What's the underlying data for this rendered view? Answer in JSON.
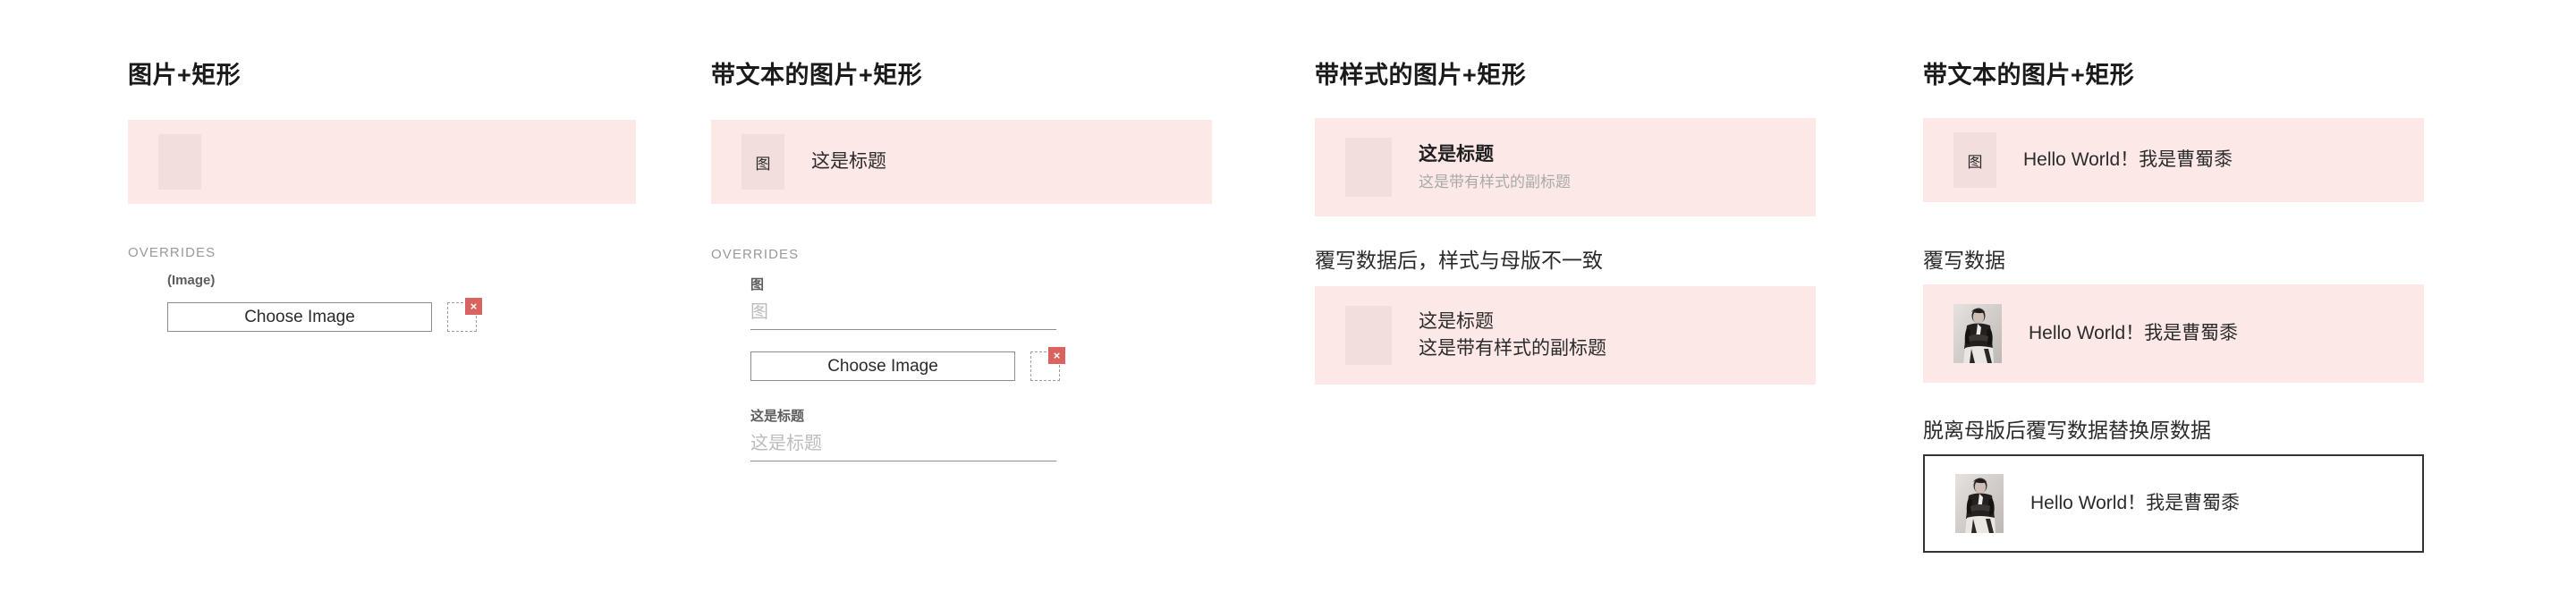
{
  "columns": [
    {
      "heading": "图片+矩形",
      "card": {
        "placeholder_label": ""
      },
      "overrides": {
        "title": "OVERRIDES",
        "image_field_label": "(Image)",
        "choose_image_label": "Choose Image",
        "delete_badge_label": "×"
      }
    },
    {
      "heading": "带文本的图片+矩形",
      "card": {
        "placeholder_label": "图",
        "title": "这是标题"
      },
      "overrides": {
        "title": "OVERRIDES",
        "image_field_label": "图",
        "image_field_placeholder": "图",
        "image_field_value": "",
        "choose_image_label": "Choose Image",
        "delete_badge_label": "×",
        "title_field_label": "这是标题",
        "title_field_placeholder": "这是标题",
        "title_field_value": ""
      }
    },
    {
      "heading": "带样式的图片+矩形",
      "card_styled": {
        "title": "这是标题",
        "subtitle": "这是带有样式的副标题"
      },
      "note": "覆写数据后，样式与母版不一致",
      "card_flat": {
        "line1": "这是标题",
        "line2": "这是带有样式的副标题"
      }
    },
    {
      "heading": "带文本的图片+矩形",
      "card_master": {
        "placeholder_label": "图",
        "text": "Hello World！我是曹蜀黍"
      },
      "note_override": "覆写数据",
      "card_override": {
        "text": "Hello World！我是曹蜀黍"
      },
      "note_detached": "脱离母版后覆写数据替换原数据",
      "card_detached": {
        "text": "Hello World！我是曹蜀黍"
      }
    }
  ],
  "colors": {
    "card_pink": "#fce9e7",
    "placeholder_pink": "#f2dedc",
    "delete_badge_red": "#d9635f",
    "muted_gray": "#a9a9a9",
    "border_dark": "#333333"
  }
}
